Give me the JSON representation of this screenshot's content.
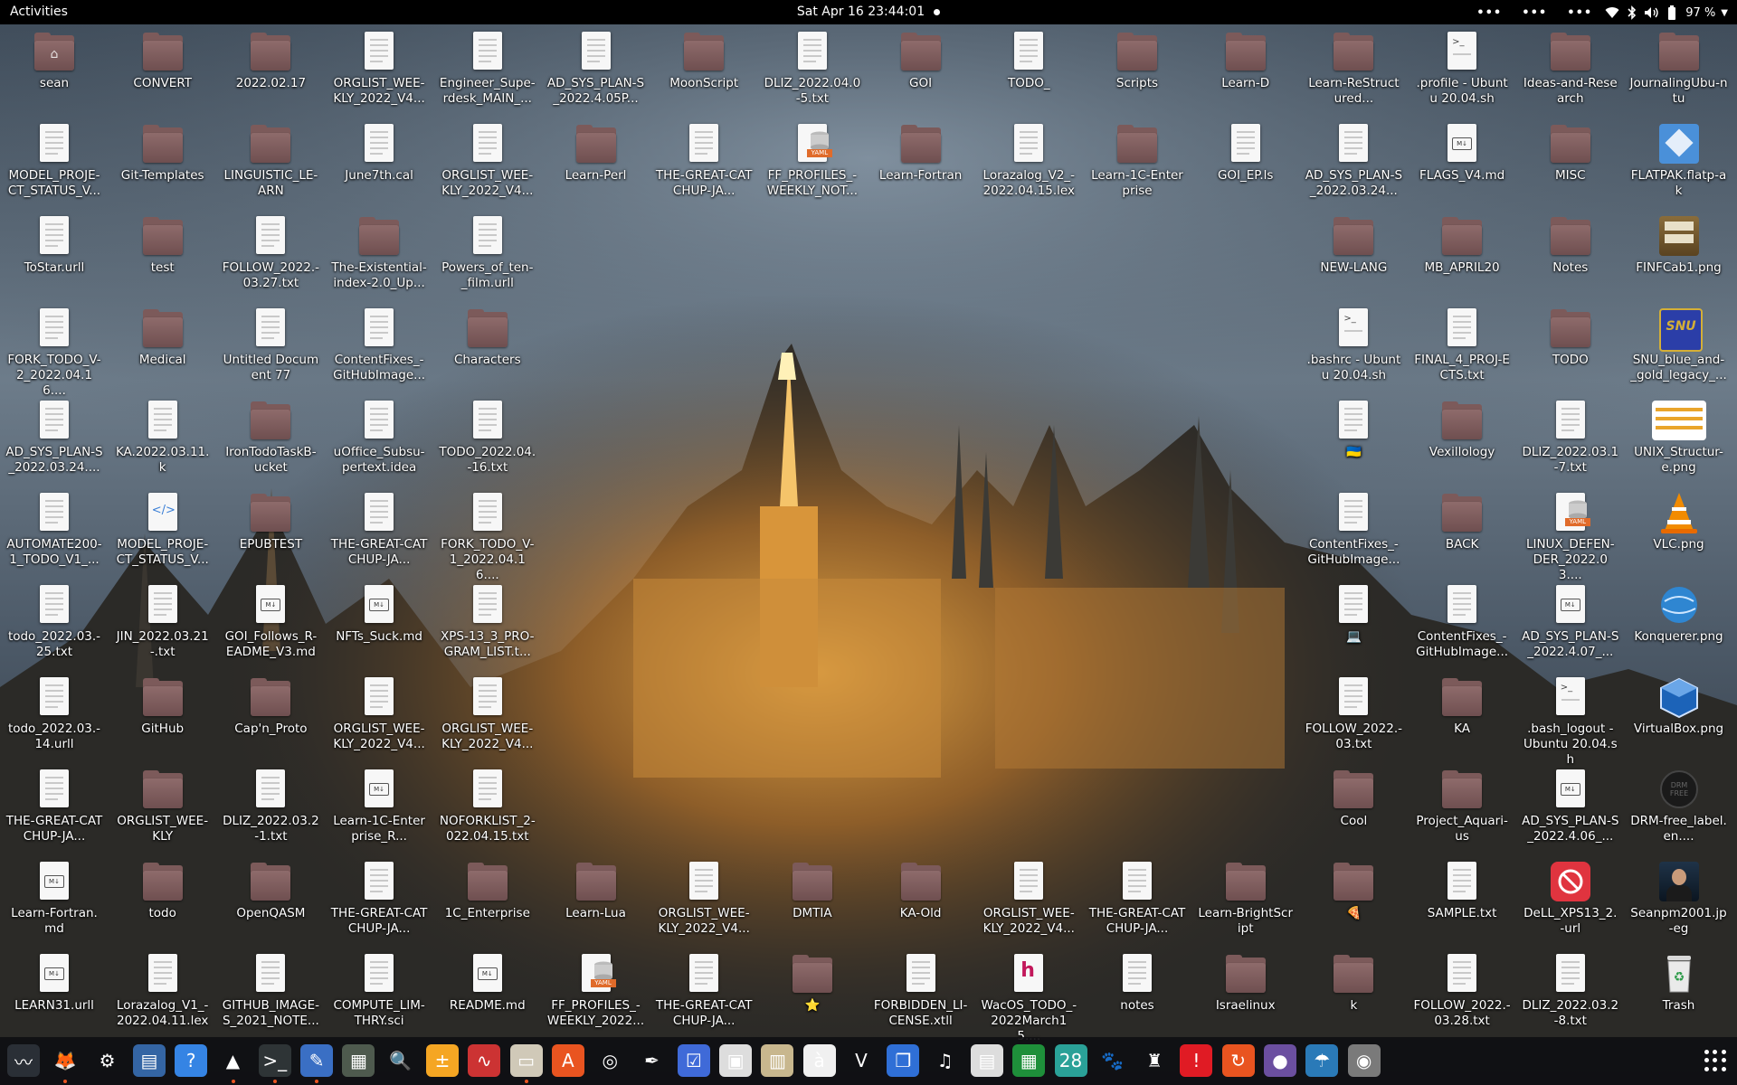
{
  "topbar": {
    "activities": "Activities",
    "clock": "Sat Apr 16  23:44:01",
    "battery": "97 %",
    "tray_dots": [
      "•••",
      "•••",
      "•••"
    ]
  },
  "desktop": {
    "icons": [
      {
        "label": "sean",
        "type": "home",
        "col": 0,
        "row": 0
      },
      {
        "label": "CONVERT",
        "type": "folder",
        "col": 1,
        "row": 0
      },
      {
        "label": "2022.02.17",
        "type": "folder",
        "col": 2,
        "row": 0
      },
      {
        "label": "ORGLIST_WEE-KLY_2022_V4...",
        "type": "doc",
        "col": 3,
        "row": 0
      },
      {
        "label": "Engineer_Supe-rdesk_MAIN_...",
        "type": "doc",
        "col": 4,
        "row": 0
      },
      {
        "label": "AD_SYS_PLAN-S_2022.4.05P...",
        "type": "doc",
        "col": 5,
        "row": 0
      },
      {
        "label": "MoonScript",
        "type": "folder",
        "col": 6,
        "row": 0
      },
      {
        "label": "DLIZ_2022.04.0-5.txt",
        "type": "doc",
        "col": 7,
        "row": 0
      },
      {
        "label": "GOI",
        "type": "folder",
        "col": 8,
        "row": 0
      },
      {
        "label": "TODO_",
        "type": "doc",
        "col": 9,
        "row": 0
      },
      {
        "label": "Scripts",
        "type": "folder",
        "col": 10,
        "row": 0
      },
      {
        "label": "Learn-D",
        "type": "folder",
        "col": 11,
        "row": 0
      },
      {
        "label": "Learn-ReStructured...",
        "type": "folder",
        "col": 12,
        "row": 0
      },
      {
        "label": ".profile - Ubuntu 20.04.sh",
        "type": "sh",
        "col": 13,
        "row": 0
      },
      {
        "label": "Ideas-and-Research",
        "type": "folder",
        "col": 14,
        "row": 0
      },
      {
        "label": "JournalingUbu-ntu",
        "type": "folder",
        "col": 15,
        "row": 0
      },
      {
        "label": "MODEL_PROJE-CT_STATUS_V...",
        "type": "doc",
        "col": 0,
        "row": 1
      },
      {
        "label": "Git-Templates",
        "type": "folder",
        "col": 1,
        "row": 1
      },
      {
        "label": "LINGUISTIC_LE-ARN",
        "type": "folder",
        "col": 2,
        "row": 1
      },
      {
        "label": "June7th.cal",
        "type": "doc",
        "col": 3,
        "row": 1
      },
      {
        "label": "ORGLIST_WEE-KLY_2022_V4...",
        "type": "doc",
        "col": 4,
        "row": 1
      },
      {
        "label": "Learn-Perl",
        "type": "folder",
        "col": 5,
        "row": 1
      },
      {
        "label": "THE-GREAT-CATCHUP-JA...",
        "type": "doc",
        "col": 6,
        "row": 1
      },
      {
        "label": "FF_PROFILES_-WEEKLY_NOT...",
        "type": "yaml",
        "col": 7,
        "row": 1
      },
      {
        "label": "Learn-Fortran",
        "type": "folder",
        "col": 8,
        "row": 1
      },
      {
        "label": "Lorazalog_V2_-2022.04.15.lex",
        "type": "doc",
        "col": 9,
        "row": 1
      },
      {
        "label": "Learn-1C-Enterprise",
        "type": "folder",
        "col": 10,
        "row": 1
      },
      {
        "label": "GOI_EP.ls",
        "type": "doc",
        "col": 11,
        "row": 1
      },
      {
        "label": "AD_SYS_PLAN-S_2022.03.24...",
        "type": "doc",
        "col": 12,
        "row": 1
      },
      {
        "label": "FLAGS_V4.md",
        "type": "md",
        "col": 13,
        "row": 1
      },
      {
        "label": "MISC",
        "type": "folder",
        "col": 14,
        "row": 1
      },
      {
        "label": "FLATPAK.flatp-ak",
        "type": "flatpak",
        "col": 15,
        "row": 1
      },
      {
        "label": "ToStar.urll",
        "type": "doc",
        "col": 0,
        "row": 2
      },
      {
        "label": "test",
        "type": "folder",
        "col": 1,
        "row": 2
      },
      {
        "label": "FOLLOW_2022.-03.27.txt",
        "type": "doc",
        "col": 2,
        "row": 2
      },
      {
        "label": "The-Existential-index-2.0_Up...",
        "type": "folder",
        "col": 3,
        "row": 2
      },
      {
        "label": "Powers_of_ten-_film.urll",
        "type": "doc",
        "col": 4,
        "row": 2
      },
      {
        "label": "NEW-LANG",
        "type": "folder",
        "col": 12,
        "row": 2
      },
      {
        "label": "MB_APRIL20",
        "type": "folder",
        "col": 13,
        "row": 2
      },
      {
        "label": "Notes",
        "type": "folder",
        "col": 14,
        "row": 2
      },
      {
        "label": "FINFCab1.png",
        "type": "cabinet",
        "col": 15,
        "row": 2
      },
      {
        "label": "FORK_TODO_V-2_2022.04.16....",
        "type": "doc",
        "col": 0,
        "row": 3
      },
      {
        "label": "Medical",
        "type": "folder",
        "col": 1,
        "row": 3
      },
      {
        "label": "Untitled Document 77",
        "type": "doc",
        "col": 2,
        "row": 3
      },
      {
        "label": "ContentFixes_-GitHubImage...",
        "type": "doc",
        "col": 3,
        "row": 3
      },
      {
        "label": "Characters",
        "type": "folder",
        "col": 4,
        "row": 3
      },
      {
        "label": ".bashrc - Ubuntu 20.04.sh",
        "type": "sh",
        "col": 12,
        "row": 3
      },
      {
        "label": "FINAL_4_PROJ-ECTS.txt",
        "type": "doc",
        "col": 13,
        "row": 3
      },
      {
        "label": "TODO",
        "type": "folder",
        "col": 14,
        "row": 3
      },
      {
        "label": "SNU_blue_and-_gold_legacy_...",
        "type": "snu",
        "col": 15,
        "row": 3
      },
      {
        "label": "AD_SYS_PLAN-S_2022.03.24....",
        "type": "doc",
        "col": 0,
        "row": 4
      },
      {
        "label": "KA.2022.03.11.k",
        "type": "doc",
        "col": 1,
        "row": 4
      },
      {
        "label": "IronTodoTaskB-ucket",
        "type": "folder",
        "col": 2,
        "row": 4
      },
      {
        "label": "uOffice_Subsu-pertext.idea",
        "type": "doc",
        "col": 3,
        "row": 4
      },
      {
        "label": "TODO_2022.04.-16.txt",
        "type": "doc",
        "col": 4,
        "row": 4
      },
      {
        "label": "🇺🇦",
        "type": "doc",
        "col": 12,
        "row": 4
      },
      {
        "label": "Vexillology",
        "type": "folder",
        "col": 13,
        "row": 4
      },
      {
        "label": "DLIZ_2022.03.1-7.txt",
        "type": "doc",
        "col": 14,
        "row": 4
      },
      {
        "label": "UNIX_Structur-e.png",
        "type": "unix",
        "col": 15,
        "row": 4
      },
      {
        "label": "AUTOMATE200-1_TODO_V1_...",
        "type": "doc",
        "col": 0,
        "row": 5
      },
      {
        "label": "MODEL_PROJE-CT_STATUS_V...",
        "type": "code",
        "col": 1,
        "row": 5
      },
      {
        "label": "EPUBTEST",
        "type": "folder",
        "col": 2,
        "row": 5
      },
      {
        "label": "THE-GREAT-CATCHUP-JA...",
        "type": "doc",
        "col": 3,
        "row": 5
      },
      {
        "label": "FORK_TODO_V-1_2022.04.16....",
        "type": "doc",
        "col": 4,
        "row": 5
      },
      {
        "label": "ContentFixes_-GitHubImage...",
        "type": "doc",
        "col": 12,
        "row": 5
      },
      {
        "label": "BACK",
        "type": "folder",
        "col": 13,
        "row": 5
      },
      {
        "label": "LINUX_DEFEN-DER_2022.03....",
        "type": "yaml",
        "col": 14,
        "row": 5
      },
      {
        "label": "VLC.png",
        "type": "vlc",
        "col": 15,
        "row": 5
      },
      {
        "label": "todo_2022.03.-25.txt",
        "type": "doc",
        "col": 0,
        "row": 6
      },
      {
        "label": "JIN_2022.03.21-.txt",
        "type": "doc",
        "col": 1,
        "row": 6
      },
      {
        "label": "GOI_Follows_R-EADME_V3.md",
        "type": "md",
        "col": 2,
        "row": 6
      },
      {
        "label": "NFTs_Suck.md",
        "type": "md",
        "col": 3,
        "row": 6
      },
      {
        "label": "XPS-13_3_PRO-GRAM_LIST.t...",
        "type": "doc",
        "col": 4,
        "row": 6
      },
      {
        "label": "💻",
        "type": "doc",
        "col": 12,
        "row": 6
      },
      {
        "label": "ContentFixes_-GitHubImage...",
        "type": "doc",
        "col": 13,
        "row": 6
      },
      {
        "label": "AD_SYS_PLAN-S_2022.4.07_...",
        "type": "md",
        "col": 14,
        "row": 6
      },
      {
        "label": "Konquerer.png",
        "type": "globe",
        "col": 15,
        "row": 6
      },
      {
        "label": "todo_2022.03.-14.urll",
        "type": "doc",
        "col": 0,
        "row": 7
      },
      {
        "label": "GitHub",
        "type": "folder",
        "col": 1,
        "row": 7
      },
      {
        "label": "Cap'n_Proto",
        "type": "folder",
        "col": 2,
        "row": 7
      },
      {
        "label": "ORGLIST_WEE-KLY_2022_V4...",
        "type": "doc",
        "col": 3,
        "row": 7
      },
      {
        "label": "ORGLIST_WEE-KLY_2022_V4...",
        "type": "doc",
        "col": 4,
        "row": 7
      },
      {
        "label": "FOLLOW_2022.-03.txt",
        "type": "doc",
        "col": 12,
        "row": 7
      },
      {
        "label": "KA",
        "type": "folder",
        "col": 13,
        "row": 7
      },
      {
        "label": ".bash_logout - Ubuntu 20.04.sh",
        "type": "sh",
        "col": 14,
        "row": 7
      },
      {
        "label": "VirtualBox.png",
        "type": "vbox",
        "col": 15,
        "row": 7
      },
      {
        "label": "THE-GREAT-CATCHUP-JA...",
        "type": "doc",
        "col": 0,
        "row": 8
      },
      {
        "label": "ORGLIST_WEE-KLY",
        "type": "folder",
        "col": 1,
        "row": 8
      },
      {
        "label": "DLIZ_2022.03.2-1.txt",
        "type": "doc",
        "col": 2,
        "row": 8
      },
      {
        "label": "Learn-1C-Enterprise_R...",
        "type": "md",
        "col": 3,
        "row": 8
      },
      {
        "label": "NOFORKLIST_2-022.04.15.txt",
        "type": "doc",
        "col": 4,
        "row": 8
      },
      {
        "label": "Cool",
        "type": "folder",
        "col": 12,
        "row": 8
      },
      {
        "label": "Project_Aquari-us",
        "type": "folder",
        "col": 13,
        "row": 8
      },
      {
        "label": "AD_SYS_PLAN-S_2022.4.06_...",
        "type": "md",
        "col": 14,
        "row": 8
      },
      {
        "label": "DRM-free_label.en....",
        "type": "drm",
        "col": 15,
        "row": 8
      },
      {
        "label": "Learn-Fortran.md",
        "type": "md",
        "col": 0,
        "row": 9
      },
      {
        "label": "todo",
        "type": "folder",
        "col": 1,
        "row": 9
      },
      {
        "label": "OpenQASM",
        "type": "folder",
        "col": 2,
        "row": 9
      },
      {
        "label": "THE-GREAT-CATCHUP-JA...",
        "type": "doc",
        "col": 3,
        "row": 9
      },
      {
        "label": "1C_Enterprise",
        "type": "folder",
        "col": 4,
        "row": 9
      },
      {
        "label": "Learn-Lua",
        "type": "folder",
        "col": 5,
        "row": 9
      },
      {
        "label": "ORGLIST_WEE-KLY_2022_V4...",
        "type": "doc",
        "col": 6,
        "row": 9
      },
      {
        "label": "DMTIA",
        "type": "folder",
        "col": 7,
        "row": 9
      },
      {
        "label": "KA-Old",
        "type": "folder",
        "col": 8,
        "row": 9
      },
      {
        "label": "ORGLIST_WEE-KLY_2022_V4...",
        "type": "doc",
        "col": 9,
        "row": 9
      },
      {
        "label": "THE-GREAT-CATCHUP-JA...",
        "type": "doc",
        "col": 10,
        "row": 9
      },
      {
        "label": "Learn-BrightScript",
        "type": "folder",
        "col": 11,
        "row": 9
      },
      {
        "label": "🍕",
        "type": "folder",
        "col": 12,
        "row": 9
      },
      {
        "label": "SAMPLE.txt",
        "type": "doc",
        "col": 13,
        "row": 9
      },
      {
        "label": "DeLL_XPS13_2.-url",
        "type": "noentry",
        "col": 14,
        "row": 9
      },
      {
        "label": "Seanpm2001.jp-eg",
        "type": "photo",
        "col": 15,
        "row": 9
      },
      {
        "label": "LEARN31.urll",
        "type": "md",
        "col": 0,
        "row": 10
      },
      {
        "label": "Lorazalog_V1_-2022.04.11.lex",
        "type": "doc",
        "col": 1,
        "row": 10
      },
      {
        "label": "GITHUB_IMAGE-S_2021_NOTE...",
        "type": "doc",
        "col": 2,
        "row": 10
      },
      {
        "label": "COMPUTE_LIM-THRY.sci",
        "type": "doc",
        "col": 3,
        "row": 10
      },
      {
        "label": "README.md",
        "type": "md",
        "col": 4,
        "row": 10
      },
      {
        "label": "FF_PROFILES_-WEEKLY_2022...",
        "type": "yaml",
        "col": 5,
        "row": 10
      },
      {
        "label": "THE-GREAT-CATCHUP-JA...",
        "type": "doc",
        "col": 6,
        "row": 10
      },
      {
        "label": "⭐",
        "type": "folder",
        "col": 7,
        "row": 10
      },
      {
        "label": "FORBIDDEN_LI-CENSE.xtll",
        "type": "doc",
        "col": 8,
        "row": 10
      },
      {
        "label": "WacOS_TODO_-2022March15....",
        "type": "hdoc",
        "col": 9,
        "row": 10
      },
      {
        "label": "notes",
        "type": "doc",
        "col": 10,
        "row": 10
      },
      {
        "label": "Israelinux",
        "type": "folder",
        "col": 11,
        "row": 10
      },
      {
        "label": "k",
        "type": "folder",
        "col": 12,
        "row": 10
      },
      {
        "label": "FOLLOW_2022.-03.28.txt",
        "type": "doc",
        "col": 13,
        "row": 10
      },
      {
        "label": "DLIZ_2022.03.2-8.txt",
        "type": "doc",
        "col": 14,
        "row": 10
      },
      {
        "label": "Trash",
        "type": "trash",
        "col": 15,
        "row": 10
      }
    ]
  },
  "dock": {
    "items": [
      {
        "name": "system-monitor",
        "glyph": "〰",
        "bg": "#2a2f36",
        "running": false
      },
      {
        "name": "firefox",
        "glyph": "🦊",
        "bg": "transparent",
        "running": true
      },
      {
        "name": "settings",
        "glyph": "⚙",
        "bg": "transparent",
        "running": false
      },
      {
        "name": "text-document-viewer",
        "glyph": "▤",
        "bg": "#3465a4",
        "running": false
      },
      {
        "name": "help",
        "glyph": "?",
        "bg": "#3584e4",
        "running": false
      },
      {
        "name": "vlc",
        "glyph": "▲",
        "bg": "transparent",
        "running": true
      },
      {
        "name": "terminal",
        "glyph": ">_",
        "bg": "#2e3436",
        "running": true
      },
      {
        "name": "text-editor",
        "glyph": "✎",
        "bg": "#3a6fc4",
        "running": true
      },
      {
        "name": "workspace-switcher",
        "glyph": "▦",
        "bg": "#4e5a4e",
        "running": false
      },
      {
        "name": "document-viewer",
        "glyph": "🔍",
        "bg": "transparent",
        "running": false
      },
      {
        "name": "calculator",
        "glyph": "±",
        "bg": "#f5a623",
        "running": false
      },
      {
        "name": "waveform",
        "glyph": "∿",
        "bg": "#c33",
        "running": false
      },
      {
        "name": "files",
        "glyph": "▭",
        "bg": "#d0c9b8",
        "running": true
      },
      {
        "name": "software-center",
        "glyph": "A",
        "bg": "#e95420",
        "running": false
      },
      {
        "name": "disks",
        "glyph": "◎",
        "bg": "transparent",
        "running": false
      },
      {
        "name": "inkscape",
        "glyph": "✒",
        "bg": "transparent",
        "running": false
      },
      {
        "name": "todo",
        "glyph": "☑",
        "bg": "#3f6ad8",
        "running": false
      },
      {
        "name": "screenshot",
        "glyph": "▣",
        "bg": "#ddd",
        "running": false
      },
      {
        "name": "archive-manager",
        "glyph": "▥",
        "bg": "#c8b78e",
        "running": false
      },
      {
        "name": "character-map",
        "glyph": "à",
        "bg": "#f0f0f0",
        "running": false
      },
      {
        "name": "vim",
        "glyph": "V",
        "bg": "transparent",
        "running": false
      },
      {
        "name": "remote-desktop",
        "glyph": "❐",
        "bg": "#2f6fd6",
        "running": false
      },
      {
        "name": "music",
        "glyph": "♫",
        "bg": "transparent",
        "running": false
      },
      {
        "name": "pdf-viewer",
        "glyph": "▤",
        "bg": "#ddd",
        "running": false
      },
      {
        "name": "spreadsheet",
        "glyph": "▦",
        "bg": "#1e8f3a",
        "running": false
      },
      {
        "name": "calendar",
        "glyph": "28",
        "bg": "#2aa198",
        "running": false
      },
      {
        "name": "gimp",
        "glyph": "🐾",
        "bg": "transparent",
        "running": false
      },
      {
        "name": "game",
        "glyph": "♜",
        "bg": "transparent",
        "running": false
      },
      {
        "name": "error-report",
        "glyph": "!",
        "bg": "#e01b24",
        "running": false
      },
      {
        "name": "update",
        "glyph": "↻",
        "bg": "#e95420",
        "running": false
      },
      {
        "name": "screen-recorder",
        "glyph": "●",
        "bg": "#6b4fa0",
        "running": false
      },
      {
        "name": "weather",
        "glyph": "☂",
        "bg": "#2a7ab8",
        "running": false
      },
      {
        "name": "ubuntu-tweaks",
        "glyph": "◉",
        "bg": "#7a7a7a",
        "running": false
      }
    ],
    "show_apps": "show-applications"
  }
}
